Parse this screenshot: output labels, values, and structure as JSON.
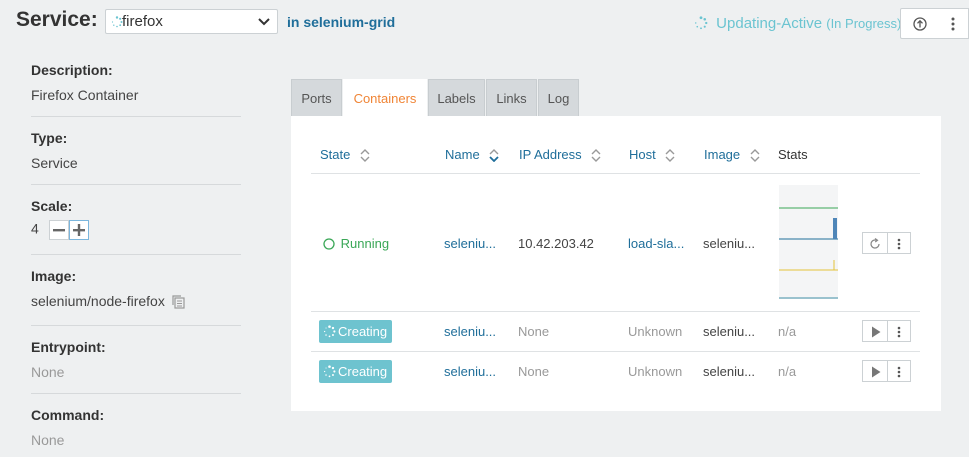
{
  "header": {
    "title": "Service:",
    "service_select": "firefox",
    "in_word": "in",
    "stack": "selenium-grid",
    "status": "Updating-Active",
    "status_progress": "(In Progress)",
    "status_color": "#6bc4d1"
  },
  "info": {
    "description_label": "Description:",
    "description_value": "Firefox Container",
    "type_label": "Type:",
    "type_value": "Service",
    "scale_label": "Scale:",
    "scale_value": "4",
    "image_label": "Image:",
    "image_value": "selenium/node-firefox",
    "entrypoint_label": "Entrypoint:",
    "entrypoint_value": "None",
    "command_label": "Command:",
    "command_value": "None"
  },
  "tabs": [
    {
      "label": "Ports"
    },
    {
      "label": "Containers"
    },
    {
      "label": "Labels"
    },
    {
      "label": "Links"
    },
    {
      "label": "Log"
    }
  ],
  "table": {
    "columns": [
      "State",
      "Name",
      "IP Address",
      "Host",
      "Image",
      "Stats"
    ],
    "rows": [
      {
        "state": "Running",
        "name": "seleniu...",
        "ip": "10.42.203.42",
        "host": "load-sla...",
        "image": "seleniu...",
        "stats": ""
      },
      {
        "state": "Creating",
        "name": "seleniu...",
        "ip": "None",
        "host": "Unknown",
        "image": "seleniu...",
        "stats": "n/a"
      },
      {
        "state": "Creating",
        "name": "seleniu...",
        "ip": "None",
        "host": "Unknown",
        "image": "seleniu...",
        "stats": "n/a"
      }
    ]
  },
  "colors": {
    "link": "#1f6e9a",
    "running": "#3aa757",
    "creating_badge": "#6ec3cf",
    "active_tab": "#f08536"
  }
}
